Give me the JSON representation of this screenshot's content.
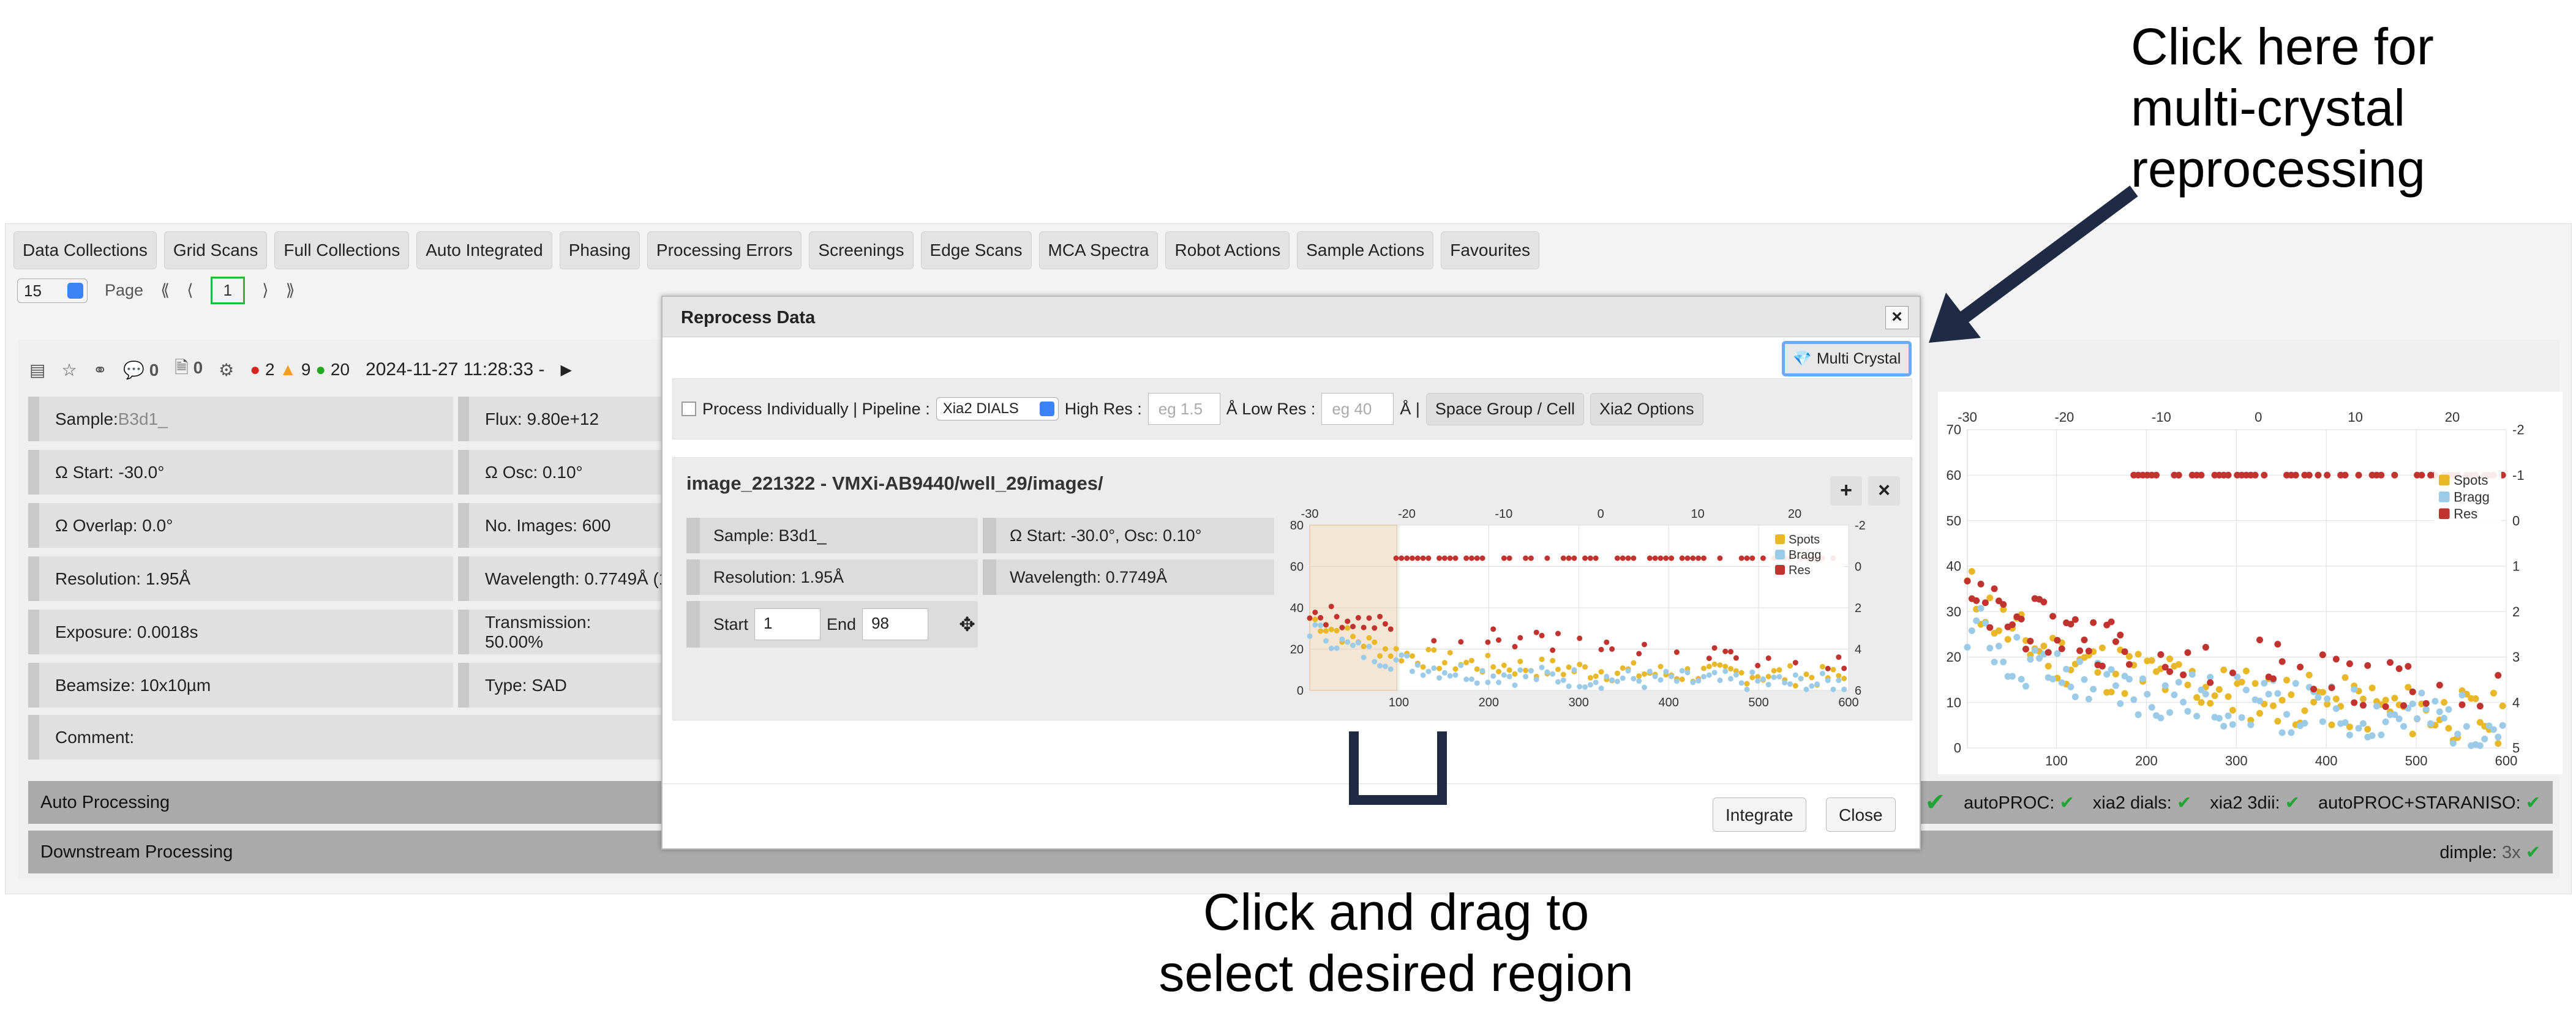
{
  "tabs": [
    "Data Collections",
    "Grid Scans",
    "Full Collections",
    "Auto Integrated",
    "Phasing",
    "Processing Errors",
    "Screenings",
    "Edge Scans",
    "MCA Spectra",
    "Robot Actions",
    "Sample Actions",
    "Favourites"
  ],
  "pager": {
    "per_page": "15",
    "page_label": "Page",
    "first": "⟪",
    "prev": "⟨",
    "current": "1",
    "next": "⟩",
    "last": "⟫"
  },
  "toolbar": {
    "comments": "0",
    "files": "0",
    "errors": "2",
    "warnings": "9",
    "ok": "20",
    "datetime": "2024-11-27 11:28:33 -"
  },
  "info": {
    "sample_label": "Sample: ",
    "sample_value": "B3d1_",
    "omega_start": "Ω Start: -30.0°",
    "omega_overlap": "Ω Overlap: 0.0°",
    "resolution": "Resolution: 1.95Å",
    "exposure": "Exposure: 0.0018s",
    "beamsize": "Beamsize: 10x10µm",
    "comment": "Comment:",
    "flux": "Flux: 9.80e+12",
    "omega_osc": "Ω Osc: 0.10°",
    "num_images": "No. Images: 600",
    "wavelength": "Wavelength: 0.7749Å (1",
    "transmission": "Transmission: 50.00%",
    "type": "Type: SAD"
  },
  "auto_processing": {
    "label": "Auto Processing",
    "items": [
      {
        "name": "autoPROC:"
      },
      {
        "name": "xia2 dials:"
      },
      {
        "name": "xia2 3dii:"
      },
      {
        "name": "autoPROC+STARANISO:"
      }
    ]
  },
  "downstream": {
    "label": "Downstream Processing",
    "dimple": "dimple:",
    "dimple_count": "3x"
  },
  "modal": {
    "title": "Reprocess Data",
    "close_x": "×",
    "multi_crystal": "Multi Crystal",
    "process_individually": "Process Individually | Pipeline :",
    "pipeline": "Xia2 DIALS",
    "high_res_label": "High Res :",
    "high_res_placeholder": "eg 1.5",
    "low_res_label": "Å Low Res :",
    "low_res_placeholder": "eg 40",
    "angstrom_sep": "Å |",
    "space_group_btn": "Space Group / Cell",
    "xia2_options_btn": "Xia2 Options",
    "dc_title": "image_221322 - VMXi-AB9440/well_29/images/",
    "dc_sample": "Sample: B3d1_",
    "dc_omega": "Ω Start: -30.0°, Osc: 0.10°",
    "dc_resolution": "Resolution: 1.95Å",
    "dc_wavelength": "Wavelength: 0.7749Å",
    "start_label": "Start",
    "start_value": "1",
    "end_label": "End",
    "end_value": "98",
    "integrate_btn": "Integrate",
    "close_btn": "Close"
  },
  "annotations": {
    "top_right": [
      "Click here for",
      "multi-crystal",
      "reprocessing"
    ],
    "bottom": [
      "Click and drag to",
      "select desired region"
    ]
  },
  "colors": {
    "spots": "#e8b828",
    "bragg": "#9ccbe8",
    "res": "#c0332e",
    "arrow": "#1f2a44",
    "green": "#21a336"
  },
  "chart_data": [
    {
      "type": "scatter",
      "x_ticks_bottom": [
        "100",
        "200",
        "300",
        "400",
        "500",
        "600"
      ],
      "x_ticks_top": [
        "-30",
        "-20",
        "-10",
        "0",
        "10",
        "20"
      ],
      "y_ticks_left": [
        "0",
        "20",
        "40",
        "60",
        "80"
      ],
      "y_ticks_right": [
        "-2",
        "0",
        "2",
        "4",
        "6"
      ],
      "legend": [
        "Spots",
        "Bragg",
        "Res"
      ],
      "selection": [
        1,
        98
      ],
      "xlim": [
        1,
        600
      ],
      "ylim": [
        0,
        80
      ],
      "series": [
        {
          "name": "Spots",
          "x": [
            1,
            50,
            100,
            150,
            200,
            300,
            400,
            500,
            600
          ],
          "y": [
            35,
            25,
            18,
            14,
            12,
            10,
            8,
            8,
            6
          ]
        },
        {
          "name": "Bragg",
          "x": [
            1,
            50,
            100,
            150,
            200,
            300,
            400,
            500,
            600
          ],
          "y": [
            30,
            20,
            14,
            10,
            8,
            6,
            5,
            4,
            3
          ]
        },
        {
          "name": "Res",
          "x": [
            1,
            50,
            100,
            150,
            200,
            300,
            400,
            500,
            600
          ],
          "y": [
            38,
            34,
            30,
            28,
            26,
            22,
            18,
            14,
            12
          ]
        }
      ]
    },
    {
      "type": "scatter",
      "x_ticks_bottom": [
        "100",
        "200",
        "300",
        "400",
        "500",
        "600"
      ],
      "x_ticks_top": [
        "-30",
        "-20",
        "-10",
        "0",
        "10",
        "20"
      ],
      "y_ticks_left": [
        "0",
        "10",
        "20",
        "30",
        "40",
        "50",
        "60",
        "70"
      ],
      "y_ticks_right": [
        "-2",
        "-1",
        "0",
        "1",
        "2",
        "3",
        "4",
        "5"
      ],
      "legend": [
        "Spots",
        "Bragg",
        "Res"
      ],
      "xlim": [
        1,
        600
      ],
      "ylim": [
        0,
        70
      ],
      "series": [
        {
          "name": "Spots",
          "x": [
            1,
            50,
            100,
            150,
            200,
            300,
            400,
            500,
            600
          ],
          "y": [
            35,
            25,
            20,
            18,
            16,
            12,
            10,
            8,
            6
          ]
        },
        {
          "name": "Bragg",
          "x": [
            1,
            50,
            100,
            150,
            200,
            300,
            400,
            500,
            600
          ],
          "y": [
            28,
            20,
            16,
            14,
            12,
            10,
            8,
            7,
            5
          ]
        },
        {
          "name": "Res",
          "x": [
            1,
            50,
            100,
            150,
            200,
            300,
            400,
            500,
            600
          ],
          "y": [
            32,
            28,
            26,
            24,
            22,
            19,
            16,
            14,
            12
          ]
        }
      ]
    }
  ]
}
